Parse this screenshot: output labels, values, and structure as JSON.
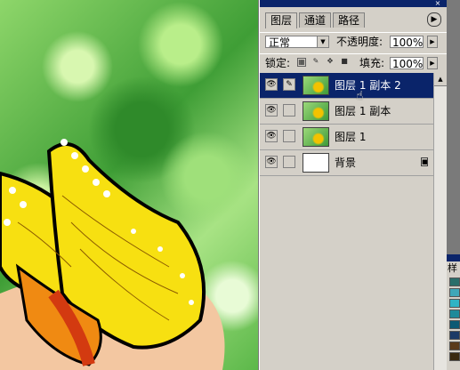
{
  "tabs": [
    "图层",
    "通道",
    "路径"
  ],
  "blend_mode": "正常",
  "opacity": {
    "label": "不透明度:",
    "value": "100%"
  },
  "fill": {
    "label": "填充:",
    "value": "100%"
  },
  "lock_label": "锁定:",
  "layers": [
    {
      "name": "图层 1 副本 2",
      "selected": true,
      "has_thumb": true,
      "locked": false
    },
    {
      "name": "图层 1 副本",
      "selected": false,
      "has_thumb": true,
      "locked": false
    },
    {
      "name": "图层 1",
      "selected": false,
      "has_thumb": true,
      "locked": false
    },
    {
      "name": "背景",
      "selected": false,
      "has_thumb": false,
      "locked": true
    }
  ],
  "swatch_tab": "样",
  "colors": {
    "selection": "#0a246a",
    "panel_bg": "#d4d0c8"
  },
  "icons": [
    "eye-icon",
    "brush-icon",
    "lock-icon",
    "menu-arrow-icon",
    "hand-cursor-icon"
  ]
}
